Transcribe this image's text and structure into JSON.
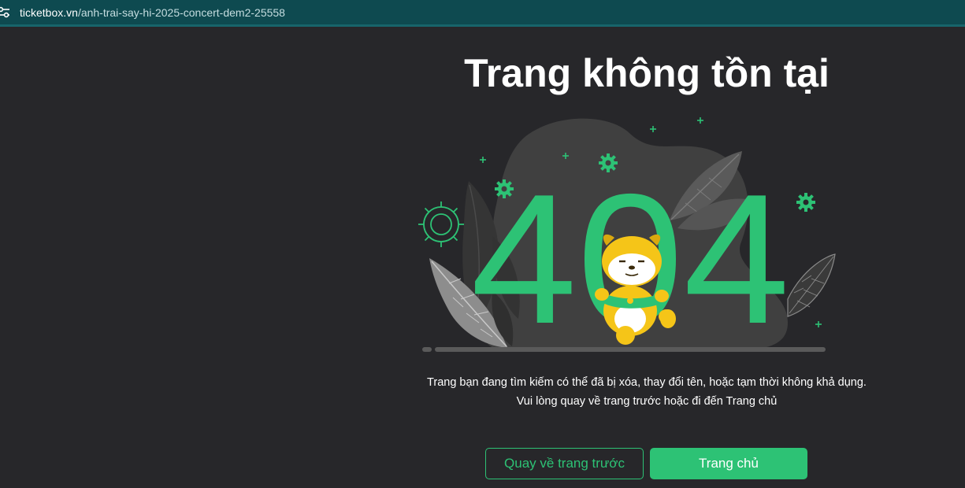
{
  "browser": {
    "url_domain": "ticketbox.vn",
    "url_path": "/anh-trai-say-hi-2025-concert-dem2-25558",
    "site_info_icon": "tune-icon"
  },
  "page": {
    "title": "Trang không tồn tại",
    "error_code": "404",
    "message_line1": "Trang bạn đang tìm kiếm có thể đã bị xóa, thay đổi tên, hoặc tạm thời không khả dụng.",
    "message_line2": "Vui lòng quay về trang trước hoặc đi đến Trang chủ",
    "back_button": "Quay về trang trước",
    "home_button": "Trang chủ"
  },
  "colors": {
    "background": "#27272a",
    "urlbar": "#0e4a50",
    "accent": "#2dc275",
    "mascot": "#f5c518"
  }
}
